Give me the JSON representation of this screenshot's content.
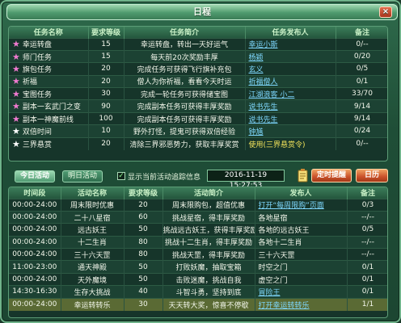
{
  "window": {
    "title": "日程",
    "close_label": "×"
  },
  "tasks": {
    "headers": [
      "任务名称",
      "要求等级",
      "任务简介",
      "任务发布人",
      "备注"
    ],
    "rows": [
      {
        "star": "pink",
        "name": "幸运转盘",
        "level": "15",
        "desc": "幸运转盘，转出一天好运气",
        "issuer": "幸运小斯",
        "issuer_style": "link",
        "note": "0/--"
      },
      {
        "star": "pink",
        "name": "师门任务",
        "level": "15",
        "desc": "每天前20次奖励丰厚",
        "issuer": "杨颖",
        "issuer_style": "link",
        "note": "0/20"
      },
      {
        "star": "pink",
        "name": "旗包任务",
        "level": "20",
        "desc": "完成任务可获得飞行旗补充包",
        "issuer": "玄义",
        "issuer_style": "link",
        "note": "0/5"
      },
      {
        "star": "pink",
        "name": "祈福",
        "level": "20",
        "desc": "僧人为你祈福，看看今天时运",
        "issuer": "祈福僧人",
        "issuer_style": "link",
        "note": "0/1"
      },
      {
        "star": "pink",
        "name": "宝图任务",
        "level": "30",
        "desc": "完成一轮任务可获得储宝图",
        "issuer": "江湖浪客 小二",
        "issuer_style": "link",
        "note": "33/70"
      },
      {
        "star": "pink",
        "name": "副本一玄武门之变",
        "level": "90",
        "desc": "完成副本任务可获得丰厚奖励",
        "issuer": "说书先生",
        "issuer_style": "link",
        "note": "9/14"
      },
      {
        "star": "pink",
        "name": "副本一神魔前线",
        "level": "100",
        "desc": "完成副本任务可获得丰厚奖励",
        "issuer": "说书先生",
        "issuer_style": "link",
        "note": "9/14"
      },
      {
        "star": "white",
        "name": "双倍时间",
        "level": "10",
        "desc": "野外打怪，提鬼可获得双倍经验",
        "issuer": "钟馗",
        "issuer_style": "link",
        "note": "0/24"
      },
      {
        "star": "white",
        "name": "三界悬赏",
        "level": "20",
        "desc": "清除三界邪恶势力，获取丰厚奖赏",
        "issuer": "使用(三界悬赏令)",
        "issuer_style": "mixed",
        "note": "0/--"
      }
    ]
  },
  "controls": {
    "tab_today": "今日活动",
    "tab_tomorrow": "明日活动",
    "checkbox_mark": "✓",
    "checkbox_label": "显示当前活动追踪信息",
    "datetime": "2016-11-19 15:27:53",
    "reminder_button": "定时提醒",
    "calendar_button": "日历"
  },
  "activities": {
    "headers": [
      "时间段",
      "活动名称",
      "要求等级",
      "活动简介",
      "发布人",
      "备注"
    ],
    "rows": [
      {
        "time": "00:00-24:00",
        "name": "周末限时优惠",
        "level": "20",
        "desc": "周末限购包，超值优惠",
        "issuer": "打开“每周限购”页面",
        "issuer_style": "link",
        "note": "0/3",
        "sel": false
      },
      {
        "time": "00:00-24:00",
        "name": "二十八星宿",
        "level": "60",
        "desc": "挑战星宿，得丰厚奖励",
        "issuer": "各地星宿",
        "issuer_style": "plain",
        "note": "--/--",
        "sel": false
      },
      {
        "time": "00:00-24:00",
        "name": "远古妖王",
        "level": "50",
        "desc": "挑战远古妖王，获得丰厚奖励",
        "issuer": "各地的远古妖王",
        "issuer_style": "plain",
        "note": "0/5",
        "sel": false
      },
      {
        "time": "00:00-24:00",
        "name": "十二生肖",
        "level": "80",
        "desc": "挑战十二生肖，得丰厚奖励",
        "issuer": "各地十二生肖",
        "issuer_style": "plain",
        "note": "--/--",
        "sel": false
      },
      {
        "time": "00:00-24:00",
        "name": "三十六天罡",
        "level": "80",
        "desc": "挑战天罡，得丰厚奖励",
        "issuer": "三十六天罡",
        "issuer_style": "plain",
        "note": "--/--",
        "sel": false
      },
      {
        "time": "11:00-23:00",
        "name": "通天神殿",
        "level": "50",
        "desc": "打败妖魔，抽取宝箱",
        "issuer": "时空之门",
        "issuer_style": "plain",
        "note": "0/1",
        "sel": false
      },
      {
        "time": "00:00-24:00",
        "name": "天外魔境",
        "level": "50",
        "desc": "击败迷魔，挑战自我",
        "issuer": "虚空之门",
        "issuer_style": "plain",
        "note": "0/1",
        "sel": false
      },
      {
        "time": "14:30-16:30",
        "name": "生存大挑战",
        "level": "40",
        "desc": "斗智斗勇，坚持到底",
        "issuer": "冒险王",
        "issuer_style": "link",
        "note": "0/1",
        "sel": false
      },
      {
        "time": "00:00-24:00",
        "name": "幸运转转乐",
        "level": "30",
        "desc": "天天转大奖，惊喜不停歇",
        "issuer": "打开幸运转转乐",
        "issuer_style": "link",
        "note": "1/1",
        "sel": true
      }
    ]
  }
}
